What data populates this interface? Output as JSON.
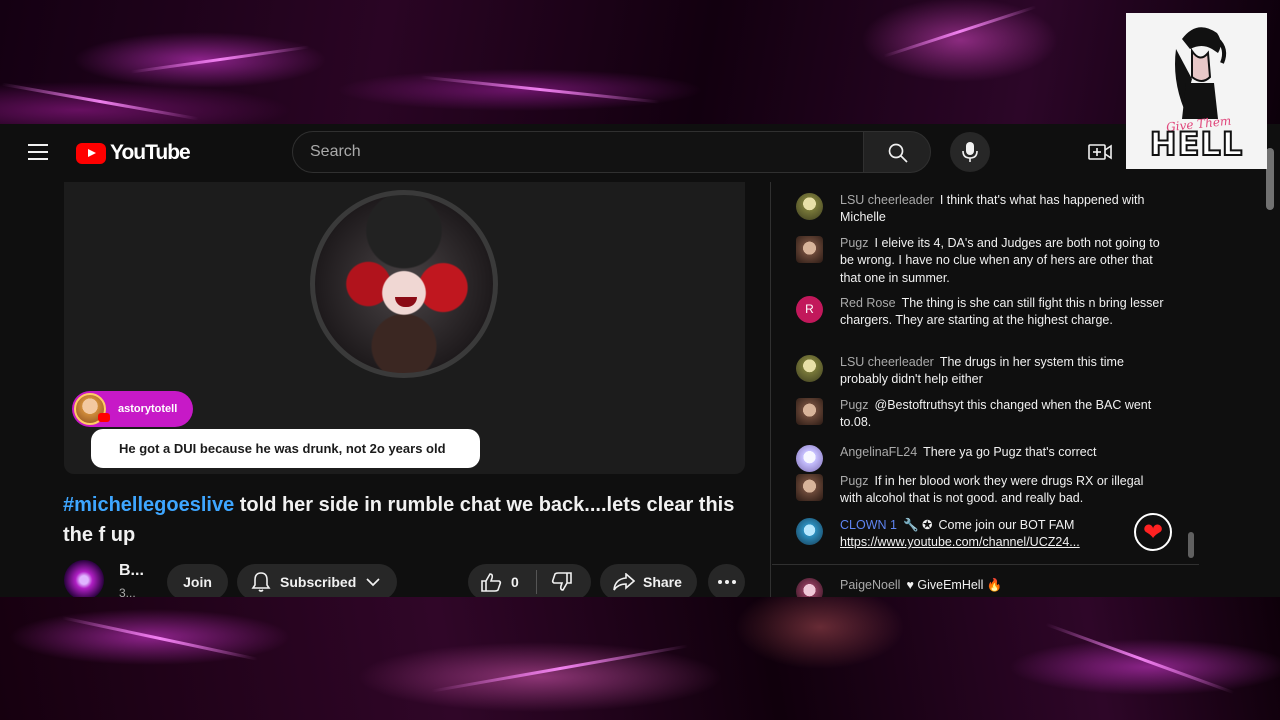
{
  "header": {
    "logo_text": "YouTube",
    "search_placeholder": "Search"
  },
  "icons": {
    "menu": "hamburger-menu-icon",
    "search": "search-icon",
    "mic": "microphone-icon",
    "create": "create-video-icon",
    "like": "thumbs-up-icon",
    "dislike": "thumbs-down-icon",
    "share": "share-arrow-icon",
    "bell": "bell-icon",
    "more": "more-horizontal-icon"
  },
  "overlay_brand": {
    "script": "Give Them",
    "word": "HELL"
  },
  "video": {
    "chip_name": "astorytotell",
    "bubble_text": "He got a DUI because he was drunk, not 2o years old"
  },
  "title": {
    "hashtag": "#michellegoeslive",
    "rest": " told her side in rumble chat we back....lets clear this the f up"
  },
  "channel": {
    "name": "B...",
    "subs": "3..."
  },
  "actions": {
    "join": "Join",
    "subscribed": "Subscribed",
    "like_count": "0",
    "share": "Share"
  },
  "chat": {
    "messages": [
      {
        "author": "LSU cheerleader",
        "text": "I think that's what has happened with Michelle"
      },
      {
        "author": "Pugz",
        "text": "I eleive its 4, DA's and Judges are both not going to be wrong. I have no clue when any of hers are other that that one in summer."
      },
      {
        "author": "Red Rose",
        "initial": "R",
        "text": "The thing is she can still fight this n bring lesser chargers. They are starting at the highest charge."
      },
      {
        "author": "LSU cheerleader",
        "text": "The drugs in her system this time probably didn't help either"
      },
      {
        "author": "Pugz",
        "text": "@Bestoftruthsyt this changed when the BAC went to.08."
      },
      {
        "author": "AngelinaFL24",
        "text": "There ya go Pugz that's correct"
      },
      {
        "author": "Pugz",
        "text": "If in her blood work they were drugs RX or illegal with alcohol that is not good. and really bad."
      },
      {
        "author": "CLOWN 1",
        "badges": "🔧 ✪",
        "text": "Come join our BOT FAM ",
        "link": "https://www.youtube.com/channel/UCZ24..."
      }
    ],
    "pinned": {
      "author": "PaigeNoell",
      "text": "♥ GiveEmHell 🔥"
    },
    "heart": "❤"
  }
}
